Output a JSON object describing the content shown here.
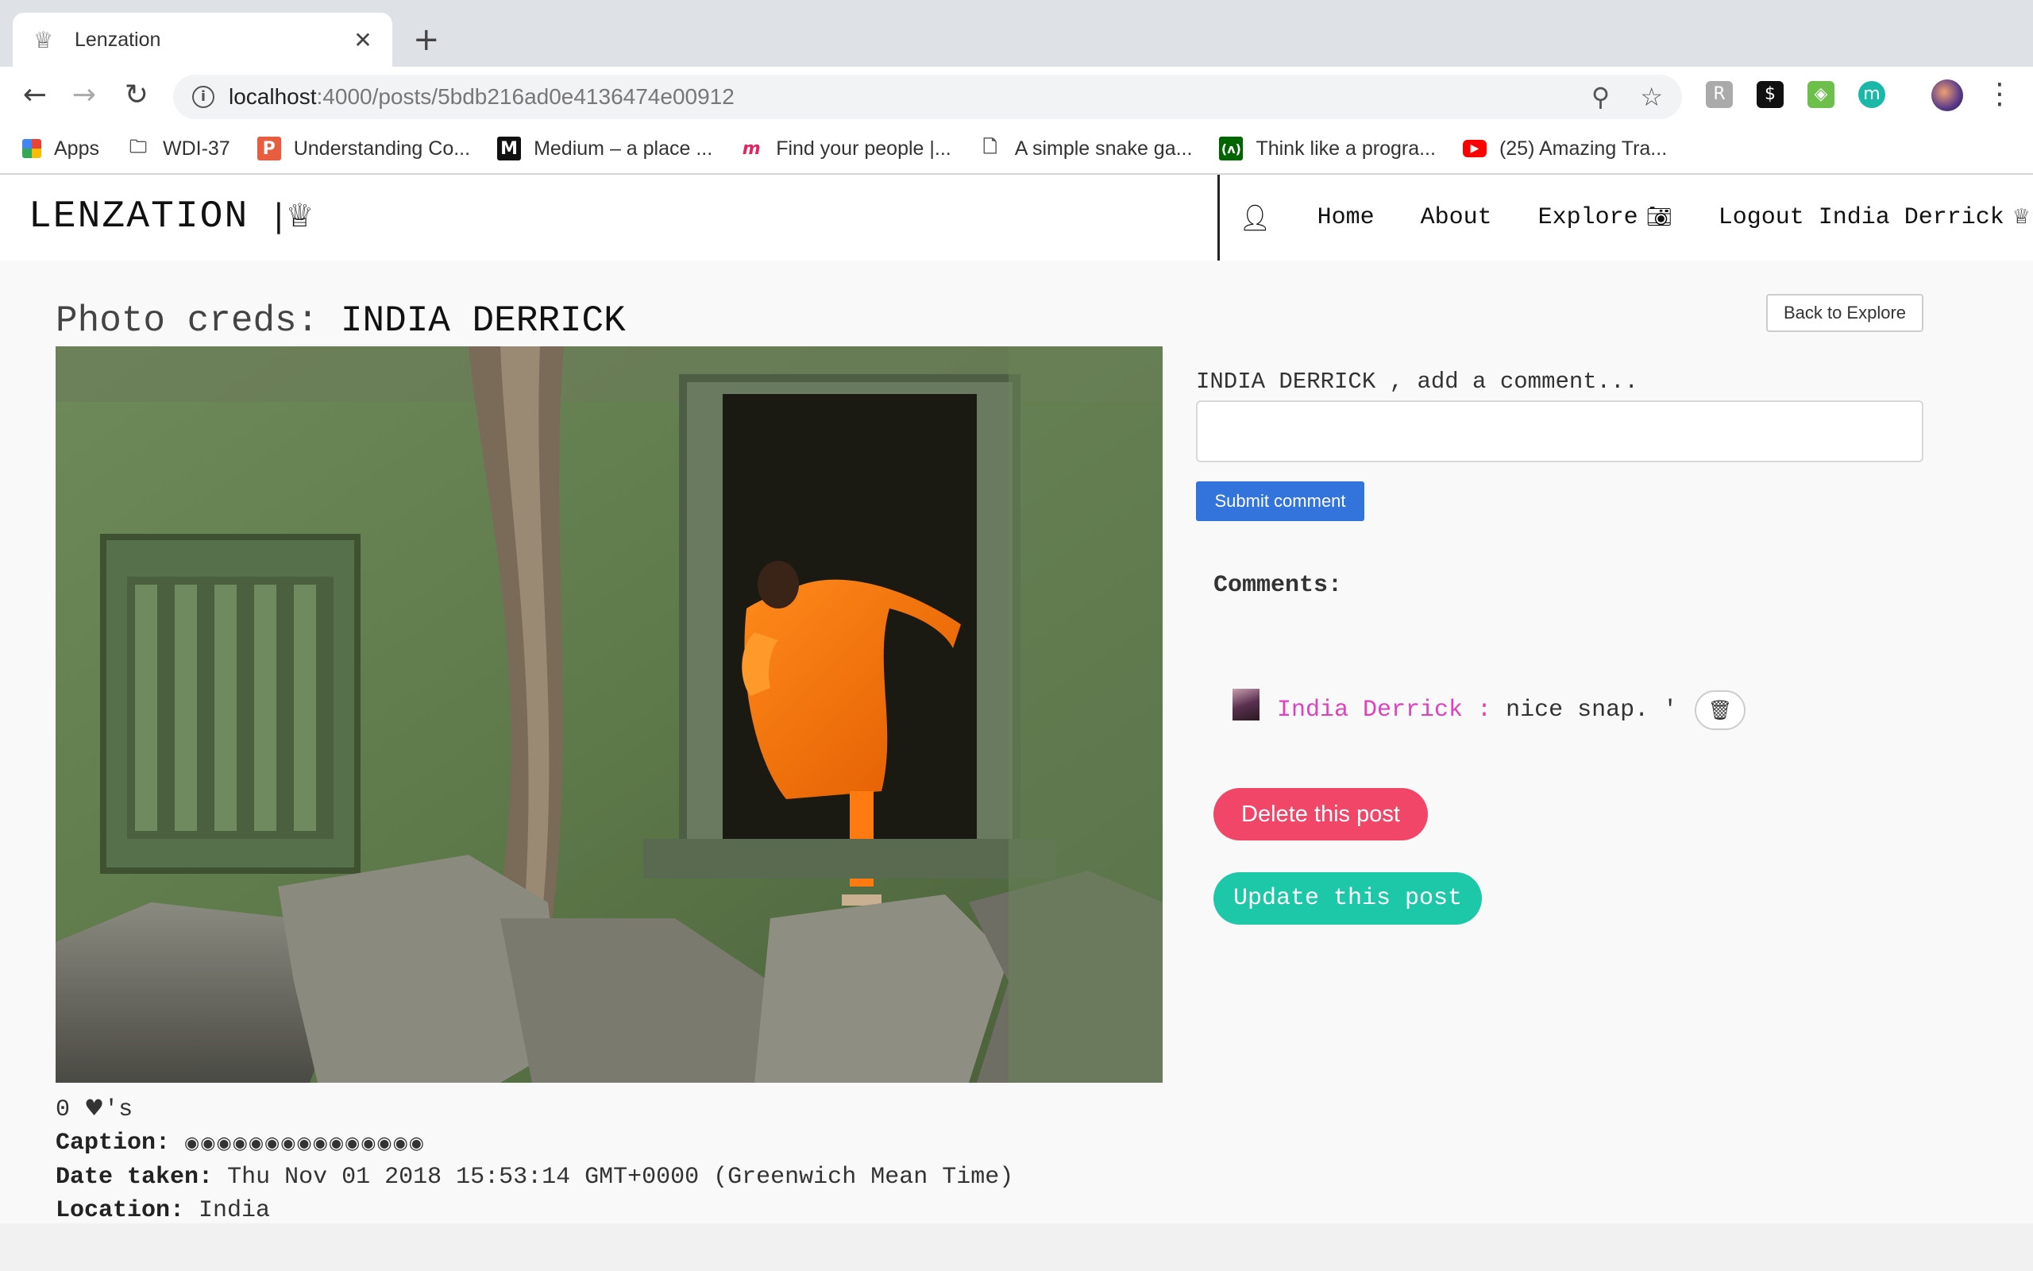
{
  "browser": {
    "tab_title": "Lenzation",
    "tab_favicon": "♕",
    "tab_close": "✕",
    "new_tab": "+",
    "url_host": "localhost",
    "url_path": ":4000/posts/5bdb216ad0e4136474e00912",
    "bookmarks": [
      {
        "label": "Apps",
        "icon": "apps-grid-icon"
      },
      {
        "label": "WDI-37",
        "icon": "folder-icon"
      },
      {
        "label": "Understanding Co...",
        "icon": "p-icon"
      },
      {
        "label": "Medium – a place ...",
        "icon": "medium-icon"
      },
      {
        "label": "Find your people |...",
        "icon": "meetup-icon"
      },
      {
        "label": "A simple snake ga...",
        "icon": "page-icon"
      },
      {
        "label": "Think like a progra...",
        "icon": "freecodecamp-icon"
      },
      {
        "label": "(25) Amazing Tra...",
        "icon": "youtube-icon"
      }
    ]
  },
  "header": {
    "brand": "LENZATION",
    "brand_suffix": "|♕",
    "nav": {
      "home": "Home",
      "about": "About",
      "explore": "Explore",
      "logout": "Logout India Derrick"
    }
  },
  "post": {
    "title_prefix": "Photo creds:",
    "owner": "INDIA DERRICK",
    "back_label": "Back to Explore",
    "likes_count": "0",
    "likes_suffix": "'s",
    "caption_label": "Caption:",
    "caption_value": "◉◉◉◉◉◉◉◉◉◉◉◉◉◉◉",
    "date_label": "Date taken:",
    "date_value": "Thu Nov 01 2018 15:53:14 GMT+0000 (Greenwich Mean Time)",
    "location_label": "Location:",
    "location_value": "India"
  },
  "comments": {
    "prompt": "INDIA DERRICK , add a comment...",
    "input_value": "",
    "submit_label": "Submit comment",
    "heading": "Comments:",
    "items": [
      {
        "author": "India Derrick",
        "separator": ":",
        "text": "nice snap. '"
      }
    ]
  },
  "actions": {
    "delete_label": "Delete this post",
    "update_label": "Update this post"
  },
  "colors": {
    "submit": "#3273dc",
    "delete": "#f14668",
    "update": "#1dc8a8",
    "comment_author": "#e040c0"
  }
}
